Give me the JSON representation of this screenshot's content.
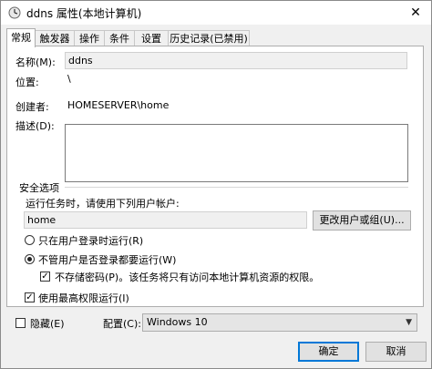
{
  "window": {
    "title": "ddns 属性(本地计算机)"
  },
  "tabs": [
    "常规",
    "触发器",
    "操作",
    "条件",
    "设置",
    "历史记录(已禁用)"
  ],
  "general": {
    "name_label": "名称(M):",
    "name_value": "ddns",
    "location_label": "位置:",
    "location_value": "\\",
    "author_label": "创建者:",
    "author_value": "HOMESERVER\\home",
    "description_label": "描述(D):",
    "description_value": ""
  },
  "security": {
    "group_title": "安全选项",
    "run_as_label": "运行任务时，请使用下列用户帐户:",
    "user_value": "home",
    "change_user_button": "更改用户或组(U)...",
    "option_logged_on": "只在用户登录时运行(R)",
    "option_always": "不管用户是否登录都要运行(W)",
    "option_always_selected": true,
    "no_store_password": "不存储密码(P)。该任务将只有访问本地计算机资源的权限。",
    "no_store_password_checked": true,
    "highest_privileges": "使用最高权限运行(I)",
    "highest_privileges_checked": true
  },
  "footer": {
    "hidden_label": "隐藏(E)",
    "hidden_checked": false,
    "configure_label": "配置(C):",
    "configure_value": "Windows 10",
    "ok_button": "确定",
    "cancel_button": "取消"
  },
  "icons": {
    "close": "close-icon",
    "chevron": "chevron-down-icon",
    "task": "task-scheduler-icon"
  },
  "colors": {
    "accent": "#0078d7"
  }
}
